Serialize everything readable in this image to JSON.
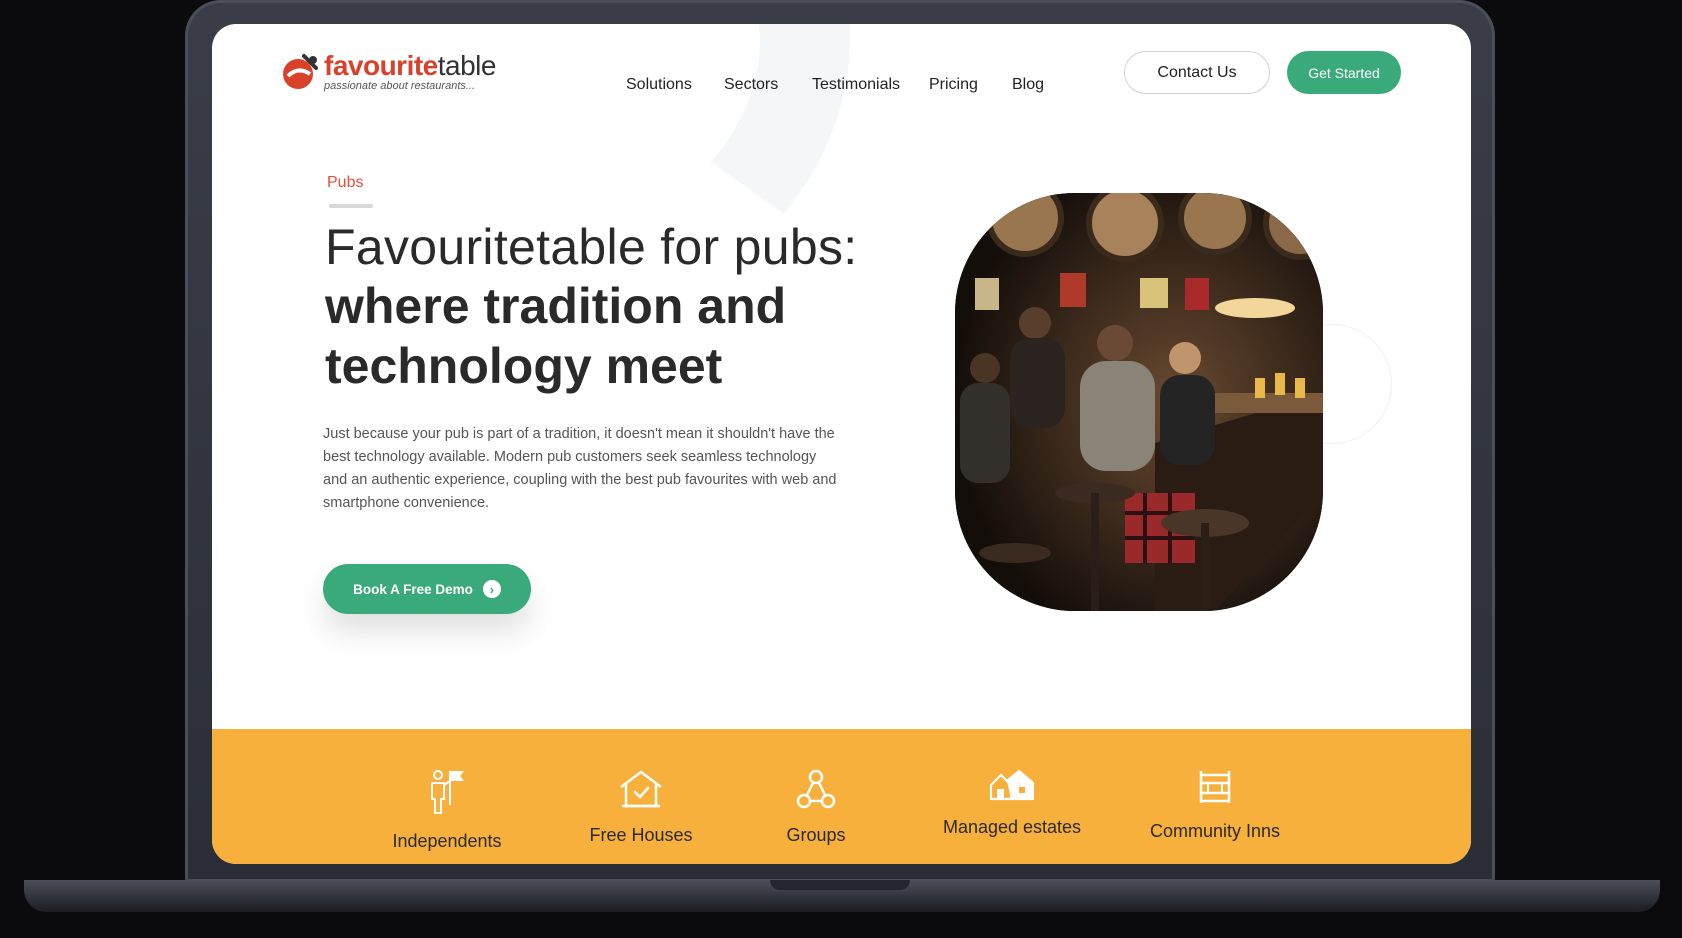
{
  "brand": {
    "name_part1": "favourite",
    "name_part2": "table",
    "tagline": "passionate about restaurants..."
  },
  "nav": {
    "items": [
      "Solutions",
      "Sectors",
      "Testimonials",
      "Pricing",
      "Blog"
    ],
    "contact_label": "Contact Us",
    "get_started_label": "Get Started"
  },
  "hero": {
    "kicker": "Pubs",
    "headline_light": "Favouritetable for pubs:",
    "headline_bold": "where tradition and technology meet",
    "body": "Just because your pub is part of a tradition, it doesn't mean it shouldn't have the best technology available. Modern pub customers seek seamless technology and an authentic experience, coupling with the best pub favourites with web and smartphone convenience.",
    "cta_label": "Book A Free Demo"
  },
  "sectors": [
    {
      "label": "Independents",
      "icon": "person-flag-icon"
    },
    {
      "label": "Free Houses",
      "icon": "house-check-icon"
    },
    {
      "label": "Groups",
      "icon": "group-network-icon"
    },
    {
      "label": "Managed estates",
      "icon": "houses-icon"
    },
    {
      "label": "Community Inns",
      "icon": "building-icon"
    }
  ],
  "colors": {
    "accent_green": "#3aaa7a",
    "accent_red": "#e0503a",
    "band_orange": "#f6b03b"
  }
}
